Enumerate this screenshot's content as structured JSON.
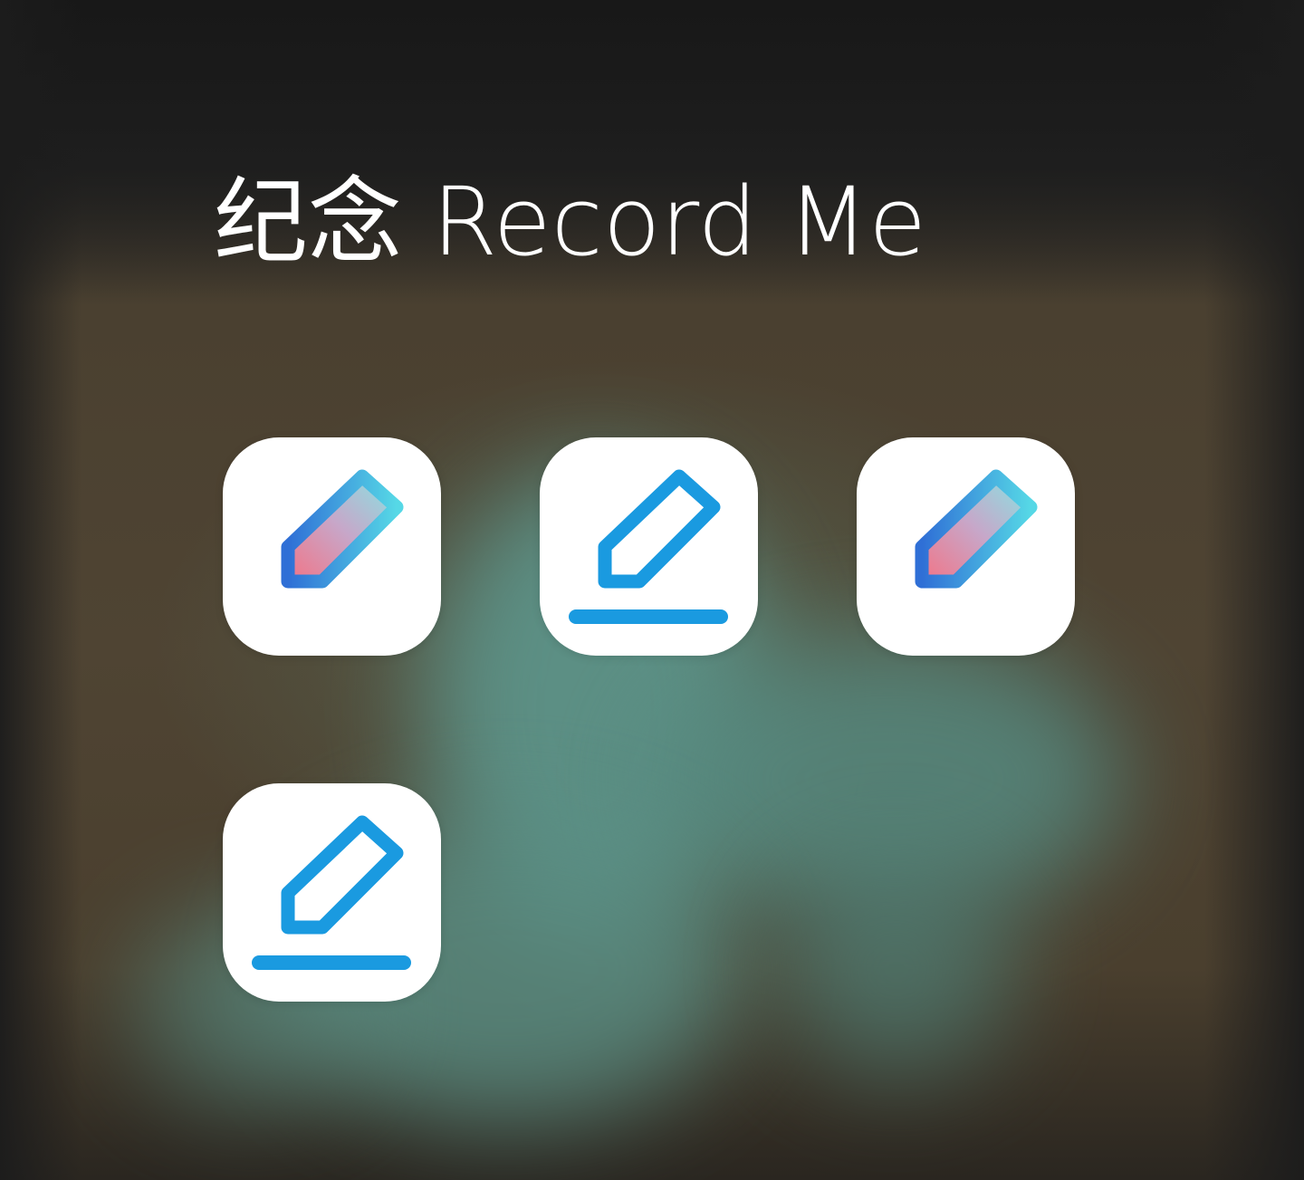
{
  "folder": {
    "title": "纪念 Record Me"
  },
  "apps": [
    {
      "name": "",
      "icon": "pencil-gradient-icon",
      "style": "gradient"
    },
    {
      "name": "",
      "icon": "pencil-outline-icon",
      "style": "outline"
    },
    {
      "name": "",
      "icon": "pencil-gradient-icon",
      "style": "gradient"
    },
    {
      "name": "",
      "icon": "pencil-outline-icon",
      "style": "outline"
    }
  ],
  "colors": {
    "icon_background": "#ffffff",
    "outline_blue": "#1a9ae0",
    "gradient_start": "#2f6fd6",
    "gradient_end": "#56d8e6",
    "fill_pink": "#f0788c",
    "fill_cyan": "#8fe3e6",
    "title_text": "#ffffff"
  }
}
